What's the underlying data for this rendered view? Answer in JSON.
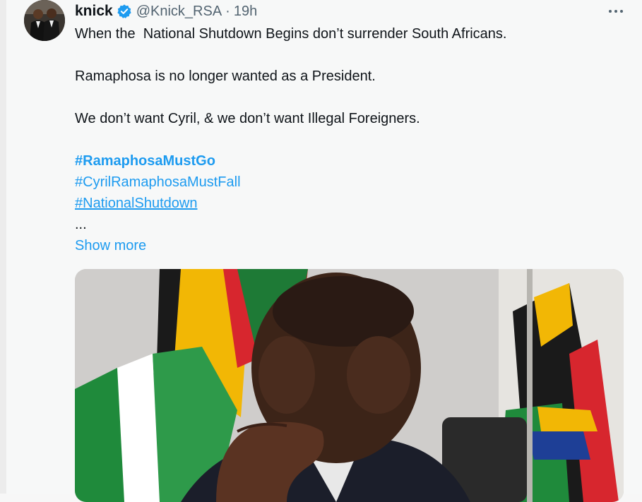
{
  "tweet": {
    "display_name": "knick",
    "handle": "@Knick_RSA",
    "separator": "·",
    "time": "19h",
    "more_label": "•••",
    "lines": {
      "l1": "When the  National Shutdown Begins don’t surrender South Africans.",
      "l2": "Ramaphosa is no longer wanted as a President.",
      "l3": "We don’t want Cyril, & we don’t want Illegal Foreigners."
    },
    "hashtags": {
      "h1": "#RamaphosaMustGo",
      "h2": "#CyrilRamaphosaMustFall",
      "h3": "#NationalShutdown"
    },
    "ellipsis": "...",
    "show_more": "Show more"
  },
  "colors": {
    "accent": "#1d9bf0",
    "text": "#0f1419",
    "secondary": "#536471",
    "verified": "#1d9bf0"
  },
  "icons": {
    "verified": "verified-badge-icon",
    "more": "more-horizontal-icon"
  }
}
